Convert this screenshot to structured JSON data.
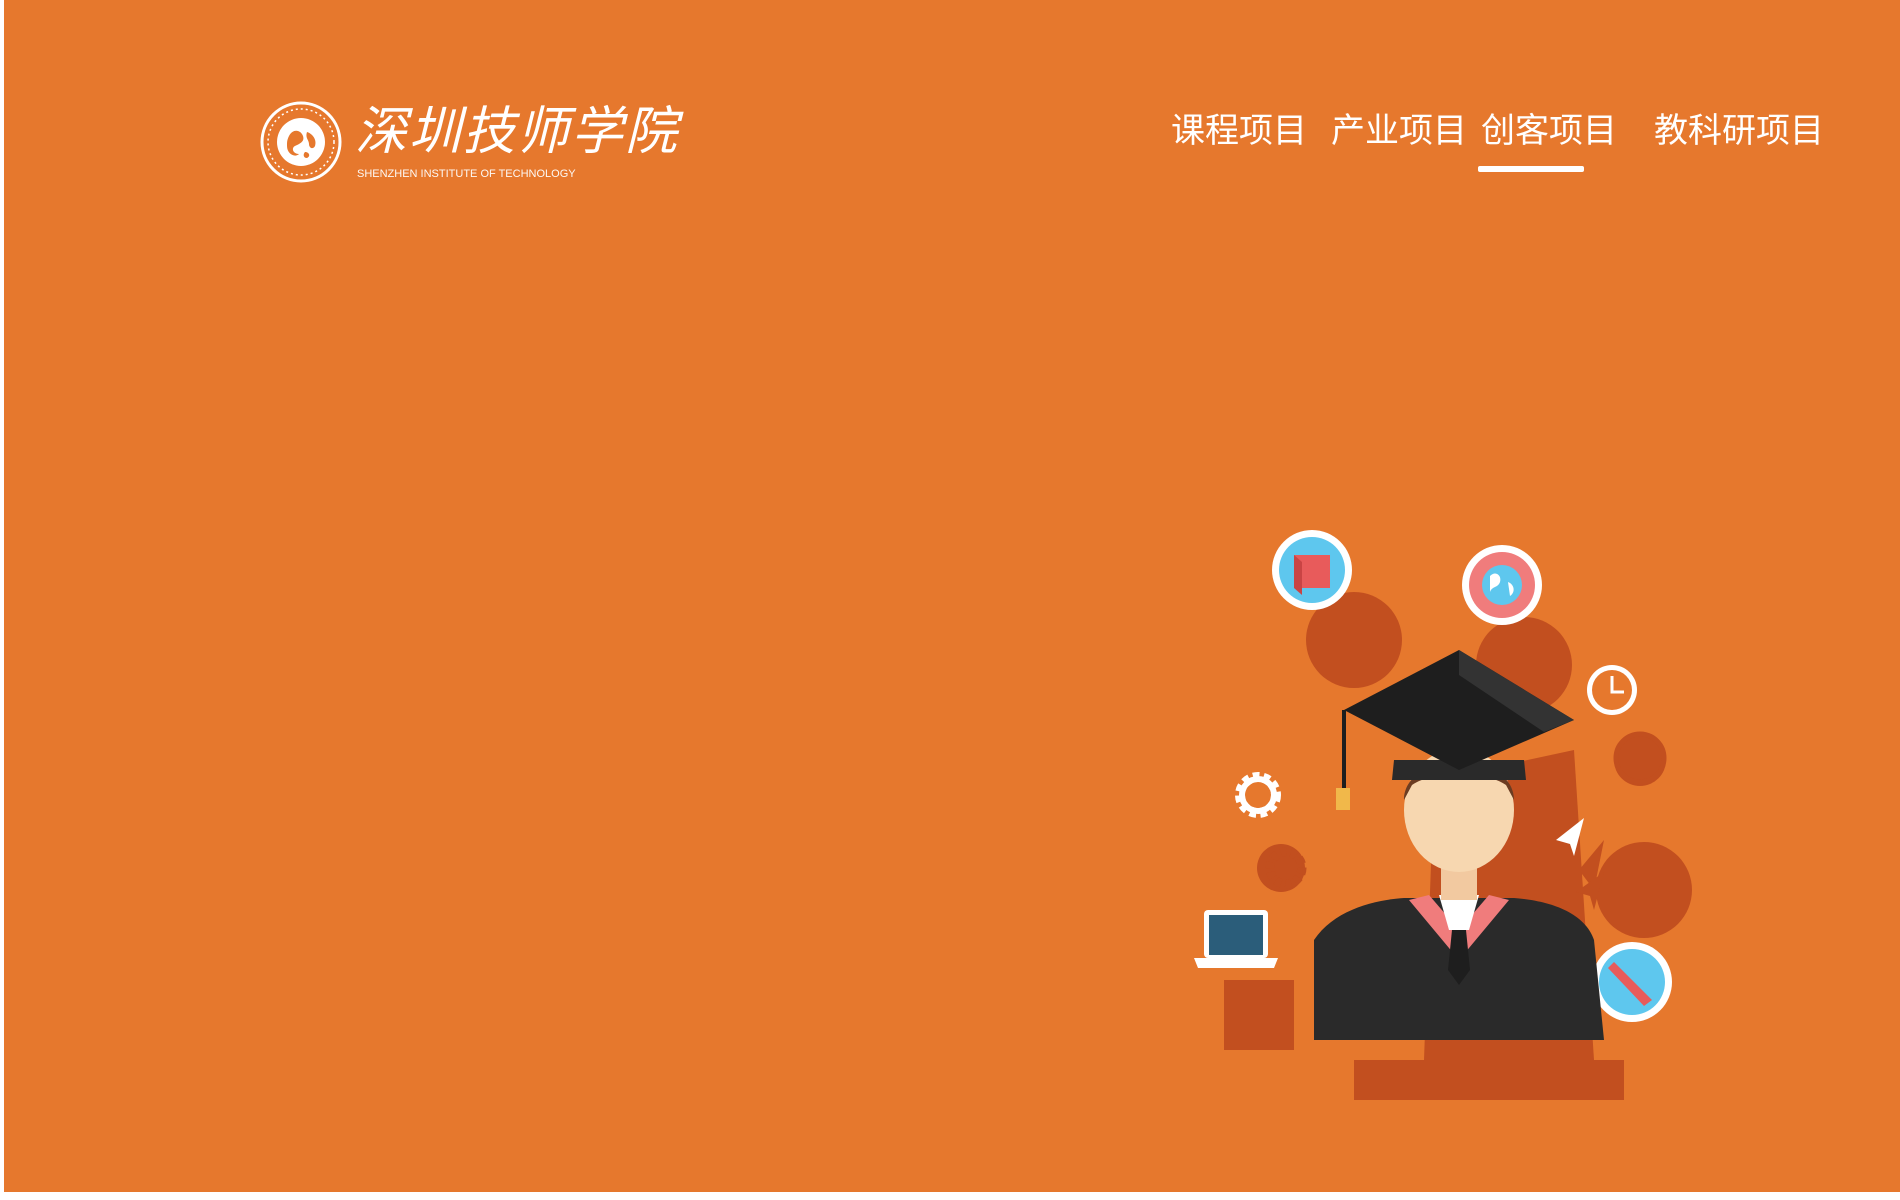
{
  "header": {
    "logo": {
      "name": "深圳技师学院",
      "subtitle": "SHENZHEN INSTITUTE OF TECHNOLOGY"
    },
    "nav": {
      "items": [
        {
          "label": "课程项目",
          "active": false
        },
        {
          "label": "产业项目",
          "active": false
        },
        {
          "label": "创客项目",
          "active": true
        },
        {
          "label": "教科研项目",
          "active": false
        }
      ]
    }
  },
  "theme": {
    "background": "#e6782d",
    "shadow": "#c24f1f",
    "icon_blue": "#5ec7ee",
    "icon_pink": "#f07c7c",
    "text": "#ffffff"
  },
  "hero": {
    "illustration": "graduate-with-icons"
  }
}
